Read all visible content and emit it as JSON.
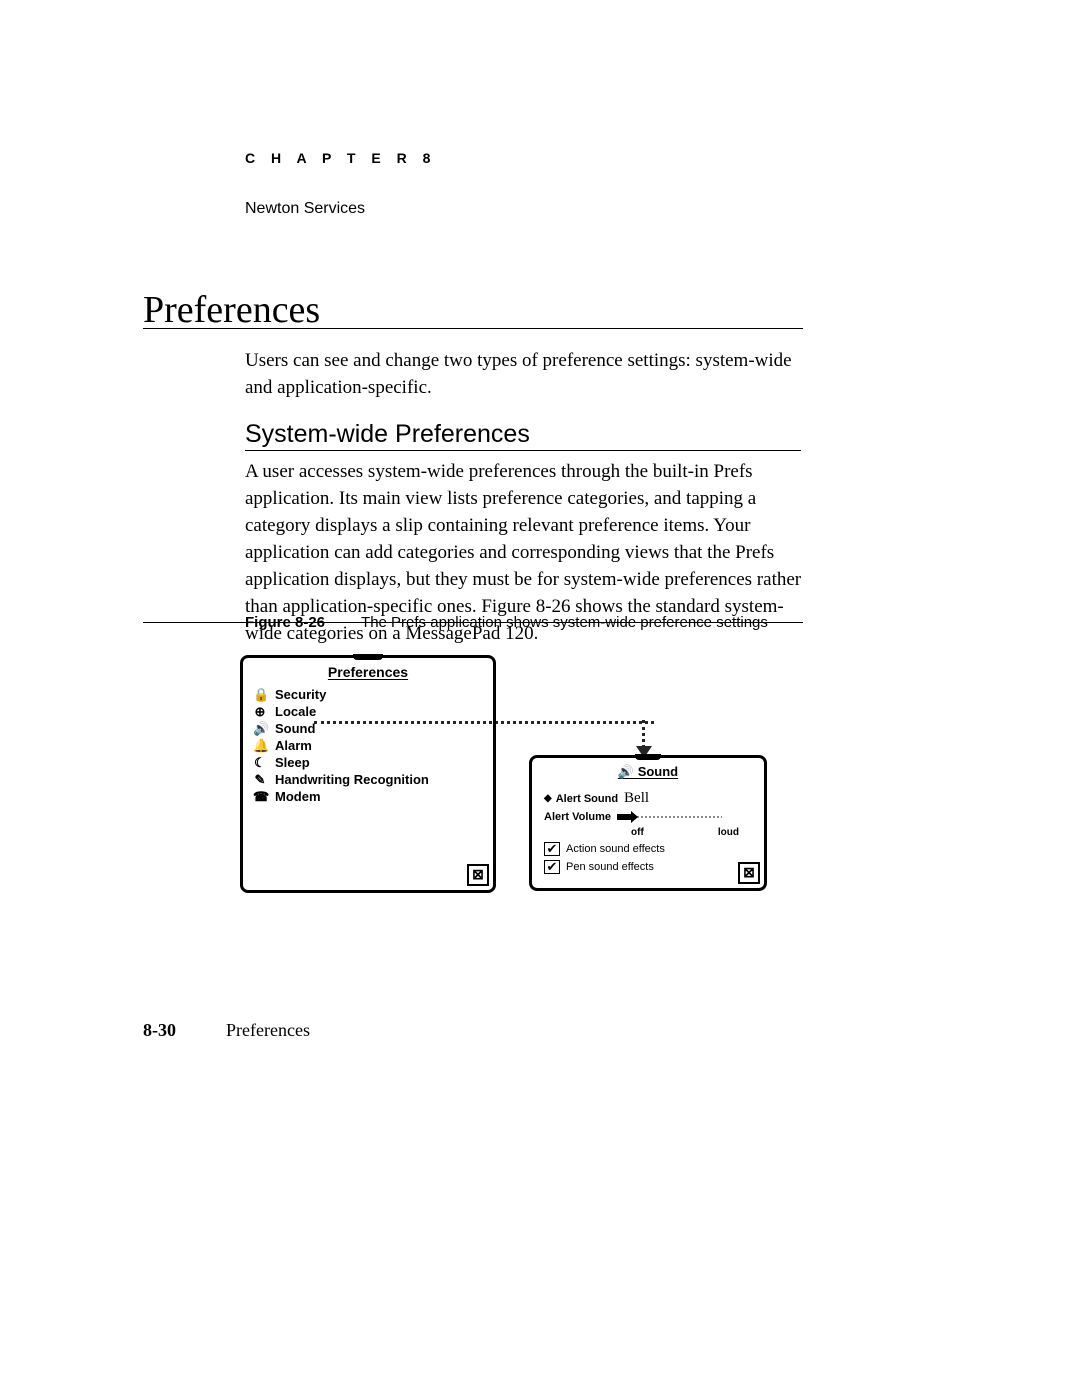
{
  "chapter": "C H A P T E R   8",
  "book_section": "Newton Services",
  "heading": "Preferences",
  "paragraph1": "Users can see and change two types of preference settings: system-wide and application-specific.",
  "subheading": "System-wide Preferences",
  "paragraph2": "A user accesses system-wide preferences through the built-in Prefs application. Its main view lists preference categories, and tapping a category displays a slip containing relevant preference items. Your application can add categories and corresponding views that the Prefs application displays, but they must be for system-wide preferences rather than application-specific ones. Figure 8-26 shows the standard system-wide categories on a MessagePad 120.",
  "figure_num": "Figure 8-26",
  "figure_caption": "The Prefs application shows system-wide preference settings",
  "prefs_window_title": "Preferences",
  "sidebar": {
    "items": [
      {
        "icon": "🔒",
        "label": "Security"
      },
      {
        "icon": "⊕",
        "label": "Locale"
      },
      {
        "icon": "🔊",
        "label": "Sound"
      },
      {
        "icon": "🔔",
        "label": "Alarm"
      },
      {
        "icon": "☾",
        "label": "Sleep"
      },
      {
        "icon": "✎",
        "label": "Handwriting Recognition"
      },
      {
        "icon": "☎",
        "label": "Modem"
      }
    ]
  },
  "slip_title": "Sound",
  "slip_icon": "🔊",
  "alert_sound_label": "Alert Sound",
  "alert_sound_value": "Bell",
  "alert_volume_label": "Alert Volume",
  "vol_min": "off",
  "vol_max": "loud",
  "check1": "Action sound effects",
  "check2": "Pen sound effects",
  "close_glyph": "⊠",
  "page_number": "8-30",
  "footer_title": "Preferences"
}
